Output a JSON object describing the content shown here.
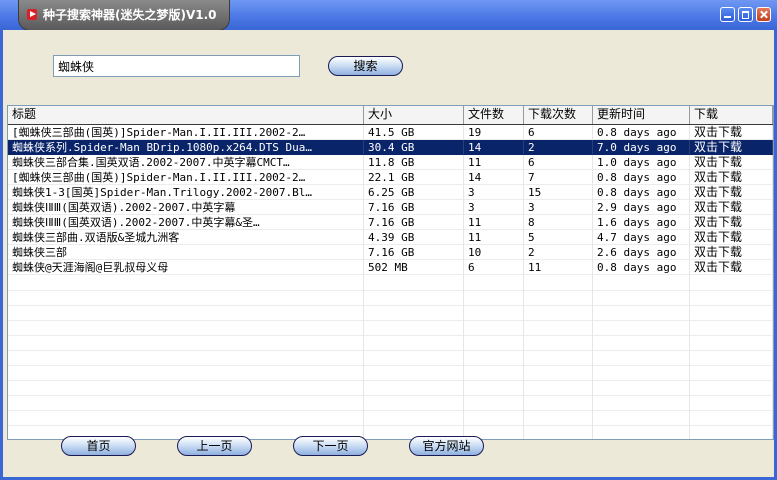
{
  "window": {
    "title": "种子搜索神器(迷失之梦版)V1.0",
    "icon": "play-icon",
    "accent": "#3a66d6",
    "title_tab_color": "#6a6a6a"
  },
  "search": {
    "value": "蜘蛛侠",
    "button_label": "搜索"
  },
  "table": {
    "headers": [
      "标题",
      "大小",
      "文件数",
      "下载次数",
      "更新时间",
      "下载"
    ],
    "selected_index": 1,
    "rows": [
      {
        "title": "[蜘蛛侠三部曲(国英)]Spider-Man.I.II.III.2002-2…",
        "size": "41.5 GB",
        "files": "19",
        "downloads": "6",
        "updated": "0.8 days ago",
        "action": "双击下载"
      },
      {
        "title": "蜘蛛侠系列.Spider-Man BDrip.1080p.x264.DTS Dua…",
        "size": "30.4 GB",
        "files": "14",
        "downloads": "2",
        "updated": "7.0 days ago",
        "action": "双击下载"
      },
      {
        "title": "蜘蛛侠三部合集.国英双语.2002-2007.中英字幕CMCT…",
        "size": "11.8 GB",
        "files": "11",
        "downloads": "6",
        "updated": "1.0 days ago",
        "action": "双击下载"
      },
      {
        "title": "[蜘蛛侠三部曲(国英)]Spider-Man.I.II.III.2002-2…",
        "size": "22.1 GB",
        "files": "14",
        "downloads": "7",
        "updated": "0.8 days ago",
        "action": "双击下载"
      },
      {
        "title": "蜘蛛侠1-3[国英]Spider-Man.Trilogy.2002-2007.Bl…",
        "size": "6.25 GB",
        "files": "3",
        "downloads": "15",
        "updated": "0.8 days ago",
        "action": "双击下载"
      },
      {
        "title": "蜘蛛侠ⅠⅡⅢ(国英双语).2002-2007.中英字幕",
        "size": "7.16 GB",
        "files": "3",
        "downloads": "3",
        "updated": "2.9 days ago",
        "action": "双击下载"
      },
      {
        "title": "蜘蛛侠ⅠⅡⅢ(国英双语).2002-2007.中英字幕&圣…",
        "size": "7.16 GB",
        "files": "11",
        "downloads": "8",
        "updated": "1.6 days ago",
        "action": "双击下载"
      },
      {
        "title": "蜘蛛侠三部曲.双语版&圣城九洲客",
        "size": "4.39 GB",
        "files": "11",
        "downloads": "5",
        "updated": "4.7 days ago",
        "action": "双击下载"
      },
      {
        "title": "蜘蛛侠三部",
        "size": "7.16 GB",
        "files": "10",
        "downloads": "2",
        "updated": "2.6 days ago",
        "action": "双击下载"
      },
      {
        "title": "蜘蛛侠@天涯海阁@巨乳叔母义母",
        "size": "502 MB",
        "files": "6",
        "downloads": "11",
        "updated": "0.8 days ago",
        "action": "双击下载"
      }
    ]
  },
  "nav": {
    "first": "首页",
    "prev": "上一页",
    "next": "下一页",
    "website": "官方网站"
  }
}
